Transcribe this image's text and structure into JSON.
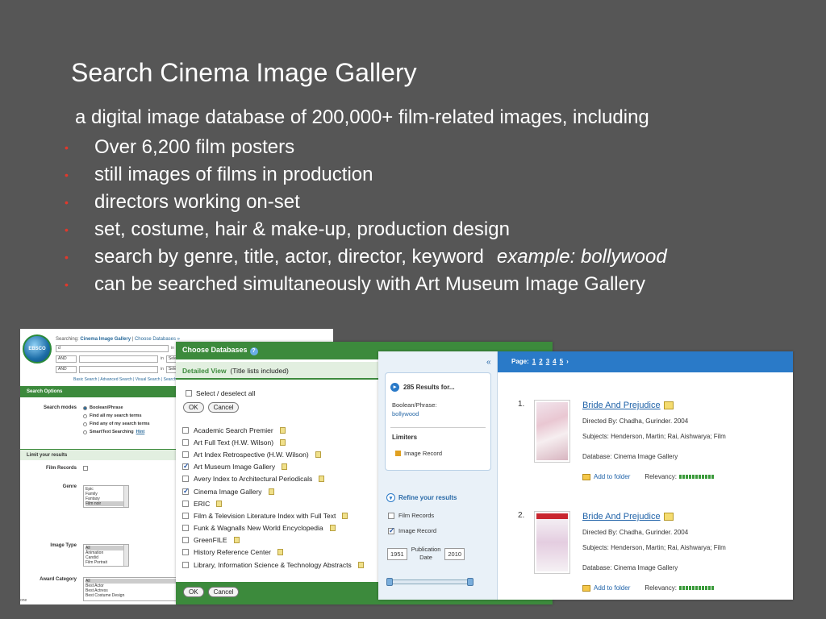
{
  "slide": {
    "title": "Search Cinema Image Gallery",
    "intro": "a digital image database of 200,000+ film-related images, including",
    "bullets": [
      "Over 6,200 film posters",
      "still images of films in production",
      "directors working on-set",
      "set, costume, hair & make-up, production design",
      "search by genre, title, actor, director, keyword",
      "can be searched simultaneously with Art Museum Image Gallery"
    ],
    "bullet_marker": "•",
    "example": "example: bollywood",
    "accent_color": "#e2382b"
  },
  "search_panel": {
    "logo": "EBSCO",
    "searching_label": "Searching:",
    "database": "Cinema Image Gallery",
    "choose_db": "Choose Databases »",
    "query": "d",
    "op1": "AND",
    "op2": "AND",
    "in_label": "in",
    "field_placeholder": "Select",
    "links": "Basic Search | Advanced Search | Visual Search | Search History",
    "search_options": "Search Options",
    "search_modes": "Search modes",
    "modes": [
      "Boolean/Phrase",
      "Find all my search terms",
      "Find any of my search terms",
      "SmartText Searching"
    ],
    "hint": "Hint",
    "limit_results": "Limit your results",
    "film_records": "Film Records",
    "genre": "Genre",
    "genre_options": [
      "Epic",
      "Family",
      "Fantasy",
      "Film noir"
    ],
    "image_type": "Image Type",
    "image_type_options": [
      "All",
      "Animation",
      "Candid",
      "Film Portrait"
    ],
    "award_category": "Award Category",
    "award_options": [
      "All",
      "Best Actor",
      "Best Actress",
      "Best Costume Design"
    ],
    "status": "one"
  },
  "db_panel": {
    "title": "Choose Databases",
    "view": "Detailed View",
    "view_note": "(Title lists included)",
    "select_all": "Select / deselect all",
    "ok": "OK",
    "cancel": "Cancel",
    "databases": [
      {
        "name": "Academic Search Premier",
        "checked": false
      },
      {
        "name": "Art Full Text (H.W. Wilson)",
        "checked": false
      },
      {
        "name": "Art Index Retrospective (H.W. Wilson)",
        "checked": false
      },
      {
        "name": "Art Museum Image Gallery",
        "checked": true
      },
      {
        "name": "Avery Index to Architectural Periodicals",
        "checked": false
      },
      {
        "name": "Cinema Image Gallery",
        "checked": true
      },
      {
        "name": "ERIC",
        "checked": false
      },
      {
        "name": "Film & Television Literature Index with Full Text",
        "checked": false
      },
      {
        "name": "Funk & Wagnalls New World Encyclopedia",
        "checked": false
      },
      {
        "name": "GreenFILE",
        "checked": false
      },
      {
        "name": "History Reference Center",
        "checked": false
      },
      {
        "name": "Library, Information Science & Technology Abstracts",
        "checked": false
      }
    ]
  },
  "results_panel": {
    "collapse": "«",
    "results_for": "285 Results for...",
    "boolean_label": "Boolean/Phrase:",
    "query": "bollywood",
    "limiters": "Limiters",
    "limiter_item": "Image Record",
    "refine": "Refine your results",
    "refine_items": [
      {
        "label": "Film Records",
        "checked": false
      },
      {
        "label": "Image Record",
        "checked": true
      }
    ],
    "year_from": "1951",
    "year_to": "2010",
    "pub_date_label_1": "Publication",
    "pub_date_label_2": "Date",
    "page_label": "Page:",
    "pages": [
      "1",
      "2",
      "3",
      "4",
      "5"
    ],
    "next_arrow": "›",
    "results": [
      {
        "num": "1.",
        "title": "Bride And Prejudice",
        "directed": "Directed By: Chadha, Gurinder. 2004",
        "subjects": "Subjects: Henderson, Martin; Rai, Aishwarya; Film",
        "database": "Database: Cinema Image Gallery",
        "add": "Add to folder",
        "relevancy": "Relevancy:"
      },
      {
        "num": "2.",
        "title": "Bride And Prejudice",
        "directed": "Directed By: Chadha, Gurinder. 2004",
        "subjects": "Subjects: Henderson, Martin; Rai, Aishwarya; Film",
        "database": "Database: Cinema Image Gallery",
        "add": "Add to folder",
        "relevancy": "Relevancy:"
      }
    ]
  }
}
